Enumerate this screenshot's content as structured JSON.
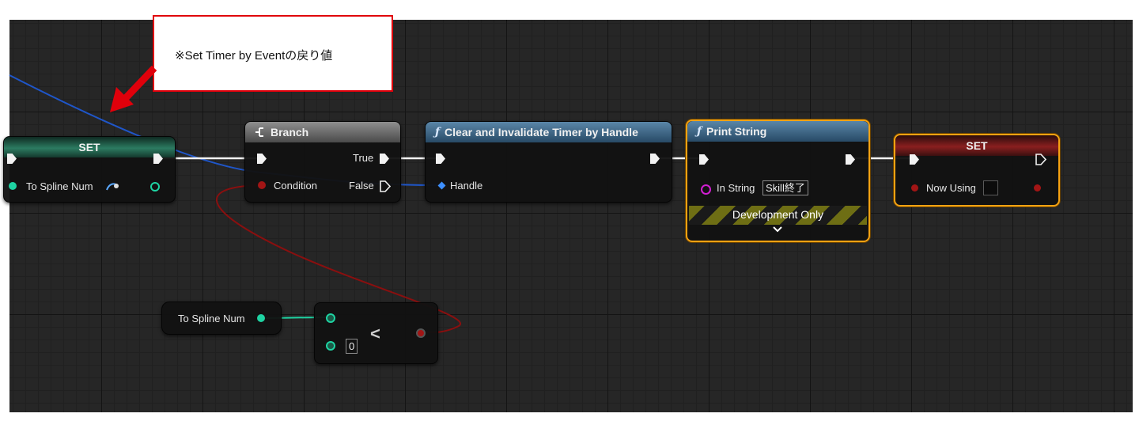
{
  "callout": {
    "text": "※Set Timer by Eventの戻り値"
  },
  "nodes": {
    "set_to_spline": {
      "title": "SET",
      "var_label": "To Spline Num"
    },
    "branch": {
      "title": "Branch",
      "true_label": "True",
      "false_label": "False",
      "condition_label": "Condition"
    },
    "clear_timer": {
      "title": "Clear and Invalidate Timer by Handle",
      "handle_label": "Handle"
    },
    "print_string": {
      "title": "Print String",
      "in_string_label": "In String",
      "in_string_value": "Skill終了",
      "footer_label": "Development Only"
    },
    "set_now_using": {
      "title": "SET",
      "var_label": "Now Using"
    },
    "get_to_spline": {
      "label": "To Spline Num"
    },
    "less_than": {
      "operator": "<",
      "b_value": "0"
    }
  },
  "icons": {
    "function": "ƒ",
    "branch": "branch-icon",
    "chevron": "chevron-down-icon"
  },
  "colors": {
    "exec": "#f2f2f2",
    "int_pin": "#1ed3a2",
    "bool_pin": "#a21515",
    "string_pin": "#d21ed2",
    "struct_pin": "#3d8fff",
    "selection": "#f5a212",
    "callout_border": "#e0000b"
  }
}
